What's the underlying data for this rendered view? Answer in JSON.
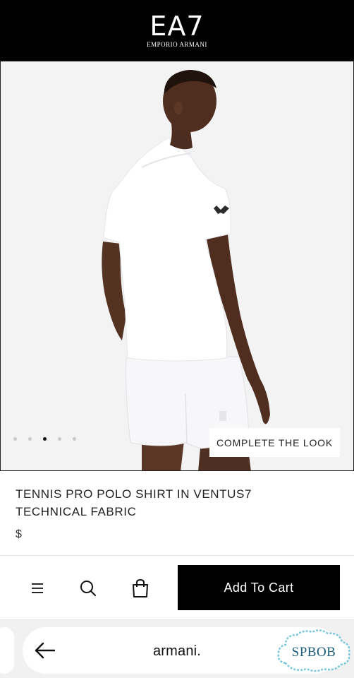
{
  "header": {
    "logo_main": "EA7",
    "logo_sub": "EMPORIO ARMANI"
  },
  "gallery": {
    "image_alt": "Model wearing white tennis polo shirt and white shorts, back view",
    "dot_count": 5,
    "active_index": 2,
    "complete_look_label": "COMPLETE THE LOOK"
  },
  "product": {
    "title": "TENNIS PRO POLO SHIRT IN VENTUS7 TECHNICAL FABRIC",
    "price": "$"
  },
  "action_bar": {
    "menu_icon": "menu-icon",
    "search_icon": "search-icon",
    "bag_icon": "shopping-bag-icon",
    "add_to_cart_label": "Add To Cart"
  },
  "browser": {
    "url": "armani.",
    "back_icon": "back-arrow-icon"
  },
  "watermark": {
    "text": "SPBOB"
  },
  "colors": {
    "header_bg": "#000000",
    "cta_bg": "#000000",
    "watermark": "#1a5c7a"
  }
}
